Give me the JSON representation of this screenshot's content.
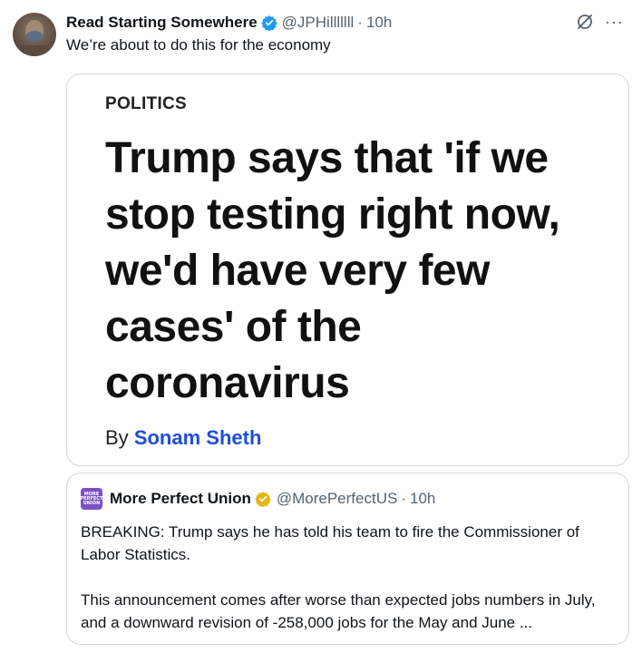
{
  "tweet": {
    "author_name": "Read Starting Somewhere",
    "handle": "@JPHilllllll",
    "separator": "·",
    "time": "10h",
    "text": "We’re about to do this for the economy",
    "more_label": "···",
    "verified_color": "#1d9bf0"
  },
  "article": {
    "section": "POLITICS",
    "headline": "Trump says that 'if we stop testing right now, we'd have very few cases' of the coronavirus",
    "byline_prefix": "By",
    "byline_author": "Sonam Sheth"
  },
  "quote": {
    "avatar_text": "MORE PERFECT UNION",
    "author_name": "More Perfect Union",
    "handle": "@MorePerfectUS",
    "separator": "·",
    "time": "10h",
    "paragraph1": "BREAKING: Trump says he has told his team to fire the Commissioner of Labor Statistics.",
    "paragraph2": "This announcement comes after worse than expected jobs numbers in July, and a downward revision of -258,000 jobs for the May and June ...",
    "verified_color": "#e2b719",
    "avatar_color": "#7b4fc7"
  }
}
